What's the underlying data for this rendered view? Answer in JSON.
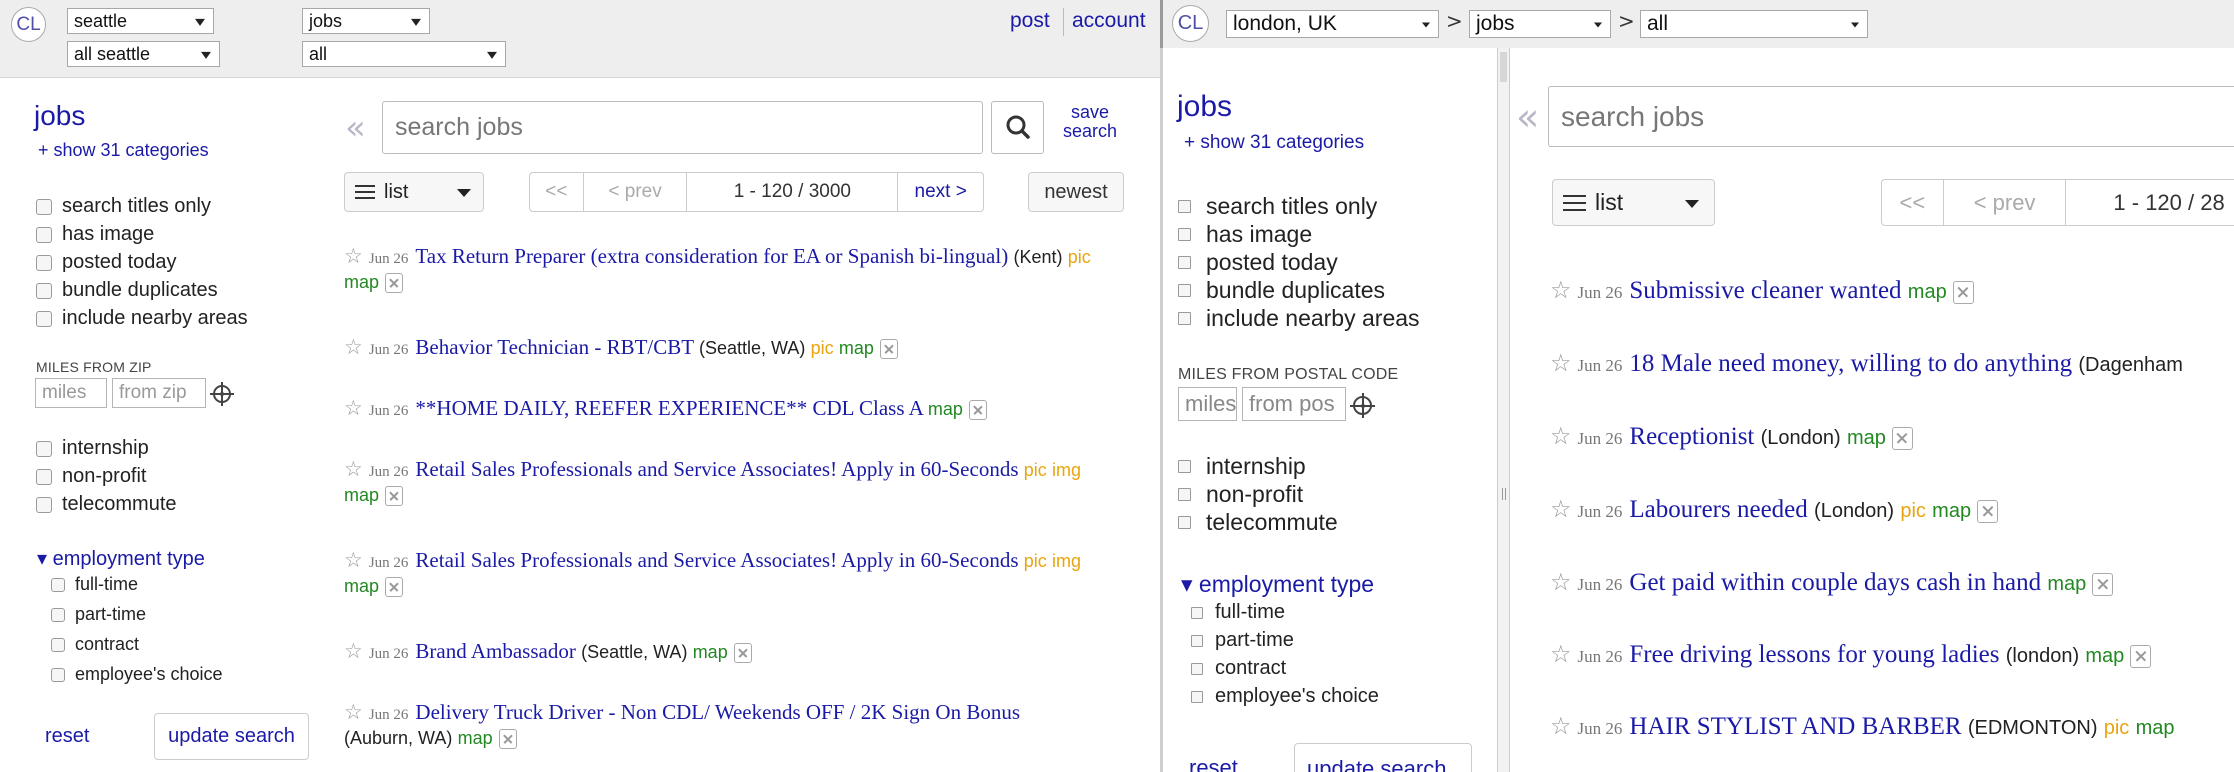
{
  "left": {
    "logo": "CL",
    "city_select": "seattle",
    "area_select": "all seattle",
    "category_select": "jobs",
    "subcategory_select": "all",
    "post_link": "post",
    "account_link": "account",
    "heading": "jobs",
    "show_categories": "+ show 31 categories",
    "filters": [
      "search titles only",
      "has image",
      "posted today",
      "bundle duplicates",
      "include nearby areas"
    ],
    "miles_label": "MILES FROM ZIP",
    "miles_placeholder": "miles",
    "zip_placeholder": "from zip",
    "job_flags": [
      "internship",
      "non-profit",
      "telecommute"
    ],
    "employment_type_label": "▾ employment type",
    "employment_types": [
      "full-time",
      "part-time",
      "contract",
      "employee's choice"
    ],
    "reset": "reset",
    "update_search": "update search",
    "search_placeholder": "search jobs",
    "save_search": [
      "save",
      "search"
    ],
    "view": "list",
    "pager": {
      "first": "<<",
      "prev": "< prev",
      "range": "1 - 120 / 3000",
      "next": "next >"
    },
    "sort": "newest",
    "listings": [
      {
        "date": "Jun 26",
        "title": "Tax Return Preparer (extra consideration for EA or Spanish bi-lingual)",
        "loc": "(Kent)",
        "pic": "pic",
        "img": "",
        "map": "map"
      },
      {
        "date": "Jun 26",
        "title": "Behavior Technician - RBT/CBT",
        "loc": "(Seattle, WA)",
        "pic": "pic",
        "img": "",
        "map": "map"
      },
      {
        "date": "Jun 26",
        "title": "**HOME DAILY, REEFER EXPERIENCE** CDL Class A",
        "loc": "",
        "pic": "",
        "img": "",
        "map": "map"
      },
      {
        "date": "Jun 26",
        "title": "Retail Sales Professionals and Service Associates! Apply in 60-Seconds",
        "loc": "",
        "pic": "pic",
        "img": "img",
        "map": "map"
      },
      {
        "date": "Jun 26",
        "title": "Retail Sales Professionals and Service Associates! Apply in 60-Seconds",
        "loc": "",
        "pic": "pic",
        "img": "img",
        "map": "map"
      },
      {
        "date": "Jun 26",
        "title": "Brand Ambassador",
        "loc": "(Seattle, WA)",
        "pic": "",
        "img": "",
        "map": "map"
      },
      {
        "date": "Jun 26",
        "title": "Delivery Truck Driver - Non CDL/ Weekends OFF / 2K Sign On Bonus",
        "loc": "(Auburn, WA)",
        "pic": "",
        "img": "",
        "map": "map"
      }
    ]
  },
  "right": {
    "logo": "CL",
    "city_select": "london, UK",
    "category_select": "jobs",
    "subcategory_select": "all",
    "gt": ">",
    "heading": "jobs",
    "show_categories": "+ show 31 categories",
    "filters": [
      "search titles only",
      "has image",
      "posted today",
      "bundle duplicates",
      "include nearby areas"
    ],
    "miles_label": "MILES FROM POSTAL CODE",
    "miles_placeholder": "miles",
    "zip_placeholder": "from pos",
    "job_flags": [
      "internship",
      "non-profit",
      "telecommute"
    ],
    "employment_type_label": "▾ employment type",
    "employment_types": [
      "full-time",
      "part-time",
      "contract",
      "employee's choice"
    ],
    "reset": "reset",
    "update_search": "update search",
    "search_placeholder": "search jobs",
    "view": "list",
    "pager": {
      "first": "<<",
      "prev": "< prev",
      "range": "1 - 120 / 28"
    },
    "listings": [
      {
        "date": "Jun 26",
        "title": "Submissive cleaner wanted",
        "loc": "",
        "pic": "",
        "map": "map"
      },
      {
        "date": "Jun 26",
        "title": "18 Male need money, willing to do anything",
        "loc": "(Dagenham",
        "pic": "",
        "map": ""
      },
      {
        "date": "Jun 26",
        "title": "Receptionist",
        "loc": "(London)",
        "pic": "",
        "map": "map"
      },
      {
        "date": "Jun 26",
        "title": "Labourers needed",
        "loc": "(London)",
        "pic": "pic",
        "map": "map"
      },
      {
        "date": "Jun 26",
        "title": "Get paid within couple days cash in hand",
        "loc": "",
        "pic": "",
        "map": "map"
      },
      {
        "date": "Jun 26",
        "title": "Free driving lessons for young ladies",
        "loc": "(london)",
        "pic": "",
        "map": "map"
      },
      {
        "date": "Jun 26",
        "title": "HAIR STYLIST AND BARBER",
        "loc": "(EDMONTON)",
        "pic": "pic",
        "map": "map"
      }
    ]
  },
  "icons": {
    "star": "star-icon",
    "search": "magnifier-icon",
    "hide": "hide-listing-icon",
    "locate": "crosshair-icon",
    "list": "list-icon"
  }
}
